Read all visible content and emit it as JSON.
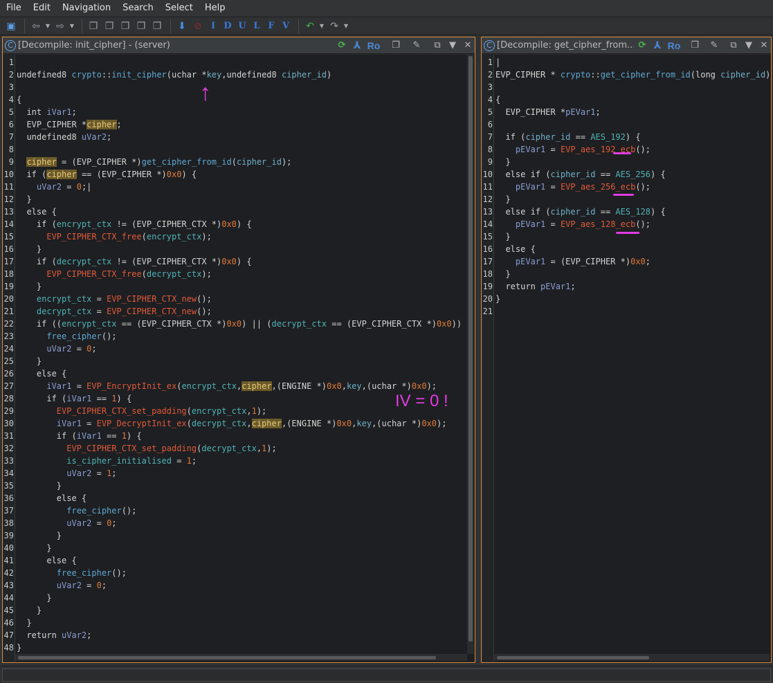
{
  "menubar": {
    "items": [
      "File",
      "Edit",
      "Navigation",
      "Search",
      "Select",
      "Help"
    ]
  },
  "toolbar": {
    "letters": [
      "I",
      "D",
      "U",
      "L",
      "F",
      "V"
    ]
  },
  "left_panel": {
    "title": "[Decompile: init_cipher] -  (server)",
    "ro_label": "Ro"
  },
  "right_panel": {
    "title": "[Decompile: get_cipher_from...",
    "ro_label": "Ro"
  },
  "annotations": {
    "iv_note": "IV = 0 !",
    "arrow": "↑"
  },
  "colors": {
    "panel_border": "#d98c3f",
    "annotation": "#e03ce0"
  }
}
